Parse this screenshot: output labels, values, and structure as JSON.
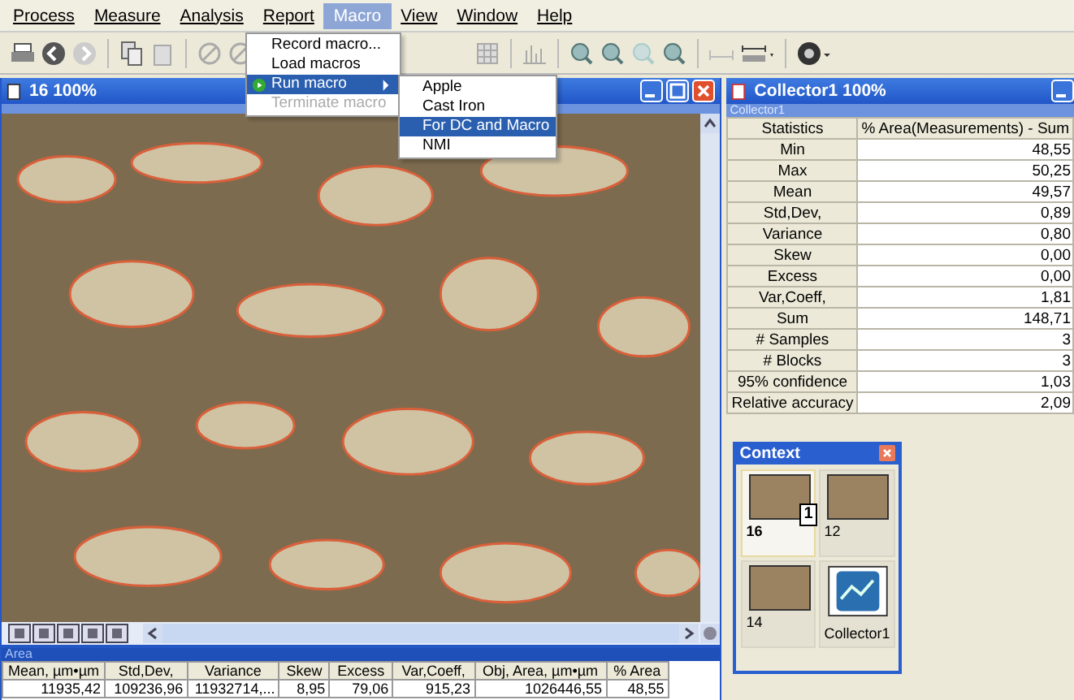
{
  "menubar": [
    {
      "label": "Process",
      "selected": false
    },
    {
      "label": "Measure",
      "selected": false
    },
    {
      "label": "Analysis",
      "selected": false
    },
    {
      "label": "Report",
      "selected": false
    },
    {
      "label": "Macro",
      "selected": true
    },
    {
      "label": "View",
      "selected": false
    },
    {
      "label": "Window",
      "selected": false
    },
    {
      "label": "Help",
      "selected": false
    }
  ],
  "macro_menu": [
    {
      "label": "Record macro...",
      "disabled": false,
      "selected": false,
      "submenu": false
    },
    {
      "label": "Load macros",
      "disabled": false,
      "selected": false,
      "submenu": false
    },
    {
      "label": "Run macro",
      "disabled": false,
      "selected": true,
      "submenu": true
    },
    {
      "label": "Terminate macro",
      "disabled": true,
      "selected": false,
      "submenu": false
    }
  ],
  "run_macro_submenu": [
    {
      "label": "Apple",
      "selected": false
    },
    {
      "label": "Cast Iron",
      "selected": false
    },
    {
      "label": "For DC and Macro",
      "selected": true
    },
    {
      "label": "NMI",
      "selected": false
    }
  ],
  "image_window": {
    "title": "16 100%"
  },
  "collector": {
    "title": "Collector1 100%",
    "subtitle": "Collector1",
    "columns": [
      "Statistics",
      "% Area(Measurements) - Sum"
    ],
    "rows": [
      {
        "label": "Min",
        "value": "48,55"
      },
      {
        "label": "Max",
        "value": "50,25"
      },
      {
        "label": "Mean",
        "value": "49,57"
      },
      {
        "label": "Std,Dev,",
        "value": "0,89"
      },
      {
        "label": "Variance",
        "value": "0,80"
      },
      {
        "label": "Skew",
        "value": "0,00"
      },
      {
        "label": "Excess",
        "value": "0,00"
      },
      {
        "label": "Var,Coeff,",
        "value": "1,81"
      },
      {
        "label": "Sum",
        "value": "148,71"
      },
      {
        "label": "# Samples",
        "value": "3"
      },
      {
        "label": "# Blocks",
        "value": "3"
      },
      {
        "label": "95% confidence",
        "value": "1,03"
      },
      {
        "label": "Relative accuracy",
        "value": "2,09"
      }
    ]
  },
  "context": {
    "title": "Context",
    "items": [
      {
        "label": "16",
        "kind": "image",
        "selected": true,
        "badge": "1"
      },
      {
        "label": "12",
        "kind": "image",
        "selected": false
      },
      {
        "label": "14",
        "kind": "image",
        "selected": false
      },
      {
        "label": "Collector1",
        "kind": "collector",
        "selected": false
      }
    ]
  },
  "area_panel": {
    "title": "Area",
    "columns": [
      "Mean, µm•µm",
      "Std,Dev,",
      "Variance",
      "Skew",
      "Excess",
      "Var,Coeff,",
      "Obj, Area, µm•µm",
      "% Area"
    ],
    "row": [
      "11935,42",
      "109236,96",
      "11932714,...",
      "8,95",
      "79,06",
      "915,23",
      "1026446,55",
      "48,55"
    ]
  }
}
